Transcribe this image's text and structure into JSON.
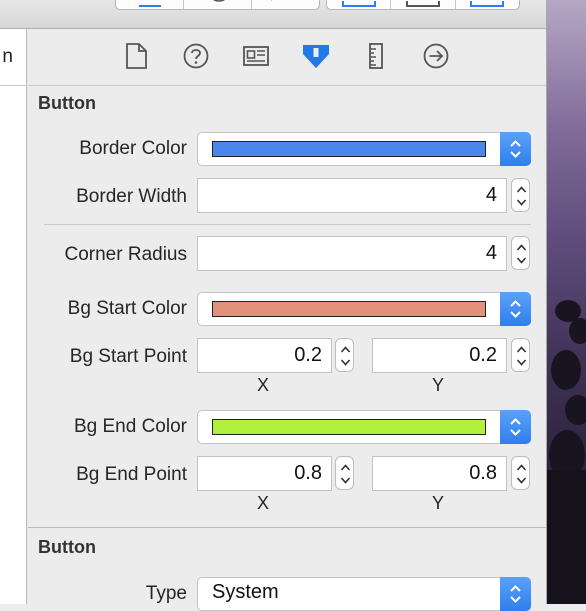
{
  "left_panel": {
    "partial_title": "n"
  },
  "inspector_tabs": [
    {
      "name": "file-inspector",
      "icon": "document-icon"
    },
    {
      "name": "quick-help-inspector",
      "icon": "help-circle-icon"
    },
    {
      "name": "identity-inspector",
      "icon": "identity-card-icon"
    },
    {
      "name": "attributes-inspector",
      "icon": "attributes-icon",
      "selected": true
    },
    {
      "name": "size-inspector",
      "icon": "ruler-icon"
    },
    {
      "name": "connections-inspector",
      "icon": "arrow-circle-icon"
    }
  ],
  "custom_section": {
    "title": "Button",
    "border_color": {
      "label": "Border Color",
      "color": "#4a86ec"
    },
    "border_width": {
      "label": "Border Width",
      "value": "4"
    },
    "corner_radius": {
      "label": "Corner Radius",
      "value": "4"
    },
    "bg_start_color": {
      "label": "Bg Start Color",
      "color": "#e2927c"
    },
    "bg_start_point": {
      "label": "Bg Start Point",
      "x": "0.2",
      "y": "0.2",
      "x_label": "X",
      "y_label": "Y"
    },
    "bg_end_color": {
      "label": "Bg End Color",
      "color": "#b2f03c"
    },
    "bg_end_point": {
      "label": "Bg End Point",
      "x": "0.8",
      "y": "0.8",
      "x_label": "X",
      "y_label": "Y"
    }
  },
  "button_section": {
    "title": "Button",
    "type": {
      "label": "Type",
      "value": "System"
    }
  },
  "colors": {
    "accent": "#2f7ef0",
    "selected_tab": "#1f7ae8"
  }
}
